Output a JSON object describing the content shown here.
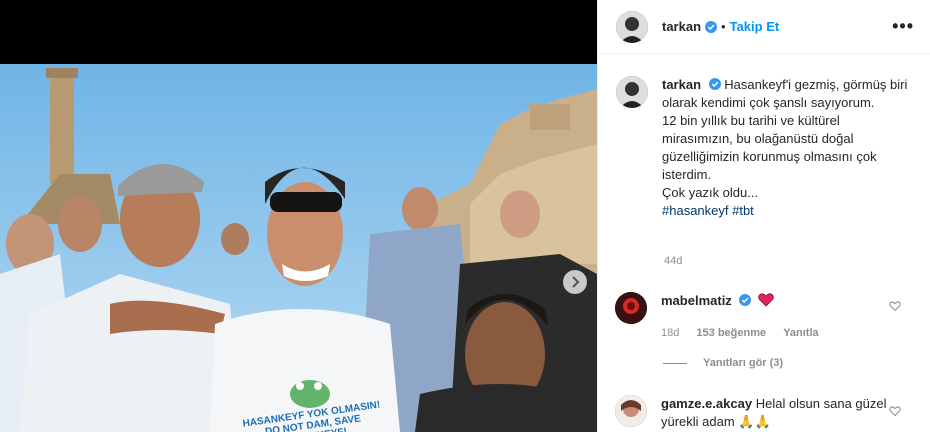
{
  "header": {
    "username": "tarkan",
    "follow_label": "Takip Et",
    "dot": "•",
    "more": "•••"
  },
  "caption": {
    "username": "tarkan",
    "text_1": "Hasankeyf'i gezmiş, görmüş biri olarak kendimi çok şanslı sayıyorum.",
    "text_2": "12 bin yıllık bu tarihi ve kültürel mirasımızın, bu olağanüstü doğal güzelliğimizin korunmuş olmasını çok isterdim.",
    "text_3": "Çok yazık oldu...",
    "hashtags": "#hasankeyf #tbt",
    "age": "44d"
  },
  "comments": [
    {
      "username": "mabelmatiz",
      "time": "18d",
      "likes": "153 beğenme",
      "reply_label": "Yanıtla",
      "view_replies": "Yanıtları gör (3)"
    },
    {
      "username": "gamze.e.akcay",
      "text": "Helal olsun sana güzel yürekli adam 🙏🙏"
    }
  ],
  "photo": {
    "shirt_line_1": "HASANKEYF YOK OLMASIN!",
    "shirt_line_2": "DO NOT DAM, SAVE HASANKEYF!"
  },
  "icons": {
    "verified": "verified-badge-icon",
    "more": "more-options-icon",
    "next": "chevron-right-icon",
    "heart": "heart-icon"
  },
  "colors": {
    "accent_blue": "#0095f6",
    "verified_blue": "#3897f0",
    "hashtag": "#00376b",
    "muted": "#8e8e8e"
  }
}
